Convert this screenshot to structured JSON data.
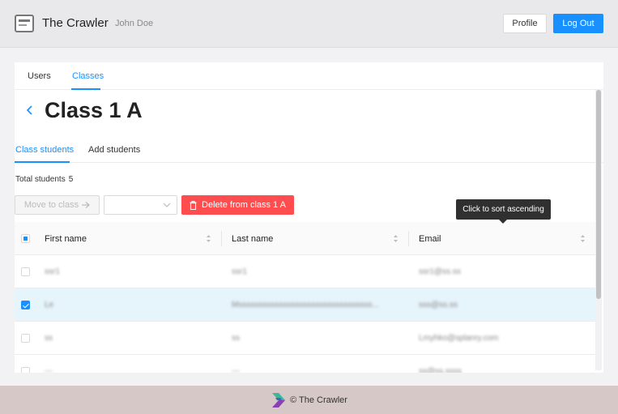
{
  "header": {
    "app_title": "The Crawler",
    "user_name": "John Doe",
    "profile_label": "Profile",
    "logout_label": "Log Out",
    "accent_color": "#1890ff"
  },
  "top_tabs": [
    {
      "label": "Users",
      "active": false
    },
    {
      "label": "Classes",
      "active": true
    }
  ],
  "page": {
    "title": "Class 1 A",
    "back_icon": "chevron-left-icon"
  },
  "sub_tabs": [
    {
      "label": "Class students",
      "active": true
    },
    {
      "label": "Add students",
      "active": false
    }
  ],
  "summary": {
    "total_label": "Total students",
    "total_value": "5"
  },
  "toolbar": {
    "move_label": "Move to class",
    "move_icon": "arrow-right-icon",
    "select_value": "",
    "delete_label": "Delete from class 1 A",
    "delete_icon": "trash-icon",
    "delete_color": "#ff4d4f"
  },
  "tooltip": {
    "text": "Click to sort ascending"
  },
  "table": {
    "columns": [
      "First name",
      "Last name",
      "Email"
    ],
    "select_all_state": "indeterminate",
    "rows": [
      {
        "first": "ssr1",
        "last": "ssr1",
        "email": "ssr1@ss.ss",
        "checked": false
      },
      {
        "first": "Le",
        "last": "Msssssssssssssssssssssssssssssssss...",
        "email": "sss@ss.ss",
        "checked": true
      },
      {
        "first": "ss",
        "last": "ss",
        "email": "Lmyhko@splanry.com",
        "checked": false
      },
      {
        "first": "---",
        "last": "---",
        "email": "ss@ss.ssss",
        "checked": false
      }
    ]
  },
  "footer": {
    "text": "© The Crawler"
  }
}
